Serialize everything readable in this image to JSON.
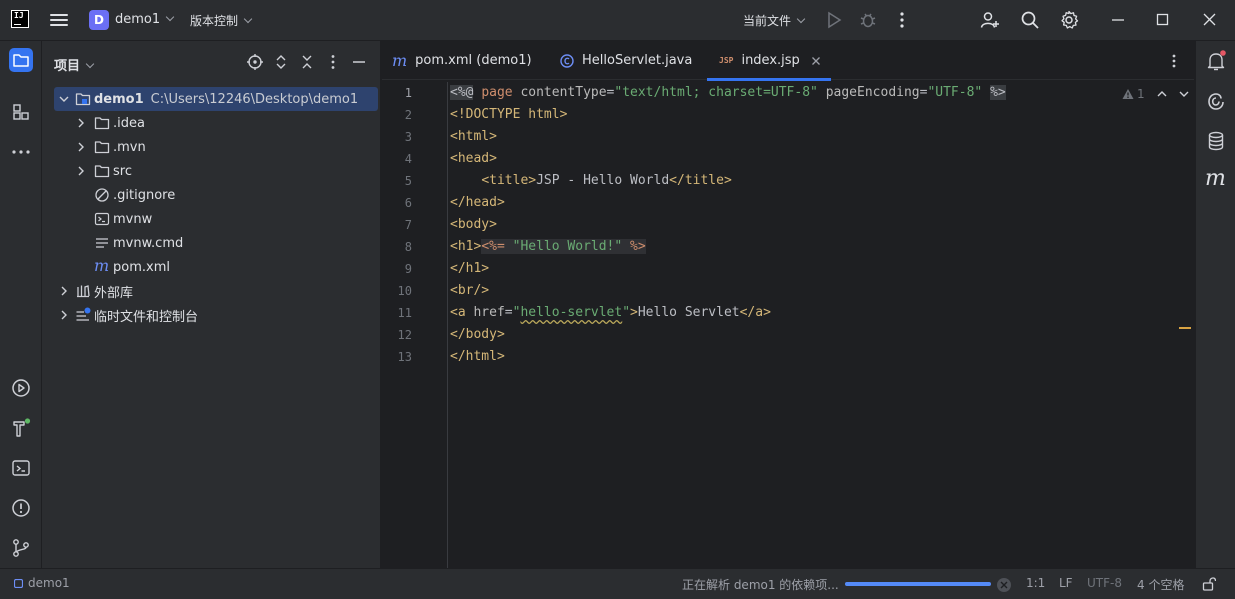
{
  "titlebar": {
    "project_badge": "D",
    "project_name": "demo1",
    "vcs_label": "版本控制",
    "run_config_label": "当前文件"
  },
  "project_panel": {
    "title": "项目",
    "tree": [
      {
        "label": "demo1",
        "path": "C:\\Users\\12246\\Desktop\\demo1",
        "icon": "module-folder-icon"
      },
      {
        "label": ".idea",
        "icon": "folder-icon"
      },
      {
        "label": ".mvn",
        "icon": "folder-icon"
      },
      {
        "label": "src",
        "icon": "folder-icon"
      },
      {
        "label": ".gitignore",
        "icon": "ignore-file-icon"
      },
      {
        "label": "mvnw",
        "icon": "shell-script-icon"
      },
      {
        "label": "mvnw.cmd",
        "icon": "text-file-icon"
      },
      {
        "label": "pom.xml",
        "icon": "maven-icon"
      },
      {
        "label": "外部库",
        "icon": "library-icon"
      },
      {
        "label": "临时文件和控制台",
        "icon": "scratches-icon"
      }
    ]
  },
  "editor": {
    "tabs": [
      {
        "label": "pom.xml (demo1)",
        "icon": "maven-icon"
      },
      {
        "label": "HelloServlet.java",
        "icon": "java-class-icon"
      },
      {
        "label": "index.jsp",
        "icon": "jsp-icon",
        "icon_text": "JSP"
      }
    ],
    "active_tab": "index.jsp",
    "warnings_count": "1",
    "line_numbers": [
      "1",
      "2",
      "3",
      "4",
      "5",
      "6",
      "7",
      "8",
      "9",
      "10",
      "11",
      "12",
      "13"
    ],
    "code": {
      "l1": {
        "open": "<%@",
        "directive": "page",
        "attr1": "contentType",
        "val1": "\"text/html; charset=UTF-8\"",
        "attr2": "pageEncoding",
        "val2": "\"UTF-8\"",
        "close": "%>"
      },
      "l2": "<!DOCTYPE html>",
      "l3": "<html>",
      "l4": "<head>",
      "l5": {
        "open": "<title>",
        "text": "JSP - Hello World",
        "close": "</title>"
      },
      "l6": "</head>",
      "l7": "<body>",
      "l8": {
        "tag": "<h1>",
        "open": "<%=",
        "str": "\"Hello World!\"",
        "close": "%>"
      },
      "l9": "</h1>",
      "l10": "<br/>",
      "l11": {
        "open": "<a",
        "attr": "href",
        "val": "hello-servlet",
        "close": ">",
        "text": "Hello Servlet",
        "end": "</a>"
      },
      "l12": "</body>",
      "l13": "</html>"
    }
  },
  "statusbar": {
    "project": "demo1",
    "task_text": "正在解析 demo1 的依赖项...",
    "task_progress": 1.0,
    "caret": "1:1",
    "line_sep": "LF",
    "encoding": "UTF-8",
    "indent": "4 个空格"
  }
}
